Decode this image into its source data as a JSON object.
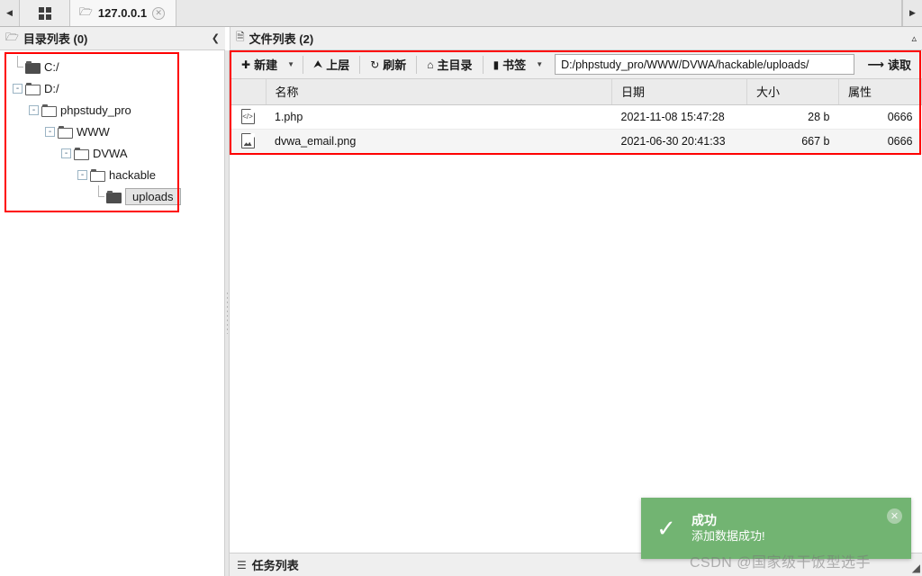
{
  "tabbar": {
    "nav_left_icon": "chevron-left-icon",
    "nav_right_icon": "chevron-right-icon",
    "grid_icon": "grid-icon",
    "tabs": [
      {
        "label": "127.0.0.1",
        "icon": "folder-icon",
        "close_icon": "close-icon"
      }
    ]
  },
  "left_panel": {
    "title": "目录列表 (0)",
    "title_icon": "folder-icon",
    "collapse_icon": "chevron-left-icon",
    "tree": [
      {
        "label": "C:/",
        "depth": 0,
        "toggle": "",
        "solid": true,
        "selected": false
      },
      {
        "label": "D:/",
        "depth": 0,
        "toggle": "-",
        "solid": false,
        "selected": false
      },
      {
        "label": "phpstudy_pro",
        "depth": 1,
        "toggle": "-",
        "solid": false,
        "selected": false
      },
      {
        "label": "WWW",
        "depth": 2,
        "toggle": "-",
        "solid": false,
        "selected": false
      },
      {
        "label": "DVWA",
        "depth": 3,
        "toggle": "-",
        "solid": false,
        "selected": false
      },
      {
        "label": "hackable",
        "depth": 4,
        "toggle": "-",
        "solid": false,
        "selected": false
      },
      {
        "label": "uploads",
        "depth": 5,
        "toggle": "",
        "solid": true,
        "selected": true
      }
    ]
  },
  "right_panel": {
    "title": "文件列表 (2)",
    "title_icon": "file-icon",
    "collapse_icon": "chevron-up-icon",
    "toolbar": {
      "new_label": "新建",
      "new_icon": "plus-circle-icon",
      "up_label": "上层",
      "up_icon": "arrow-up-icon",
      "refresh_label": "刷新",
      "refresh_icon": "refresh-icon",
      "home_label": "主目录",
      "home_icon": "home-icon",
      "bookmark_label": "书签",
      "bookmark_icon": "bookmark-icon",
      "caret_icon": "chevron-down-icon",
      "path_value": "D:/phpstudy_pro/WWW/DVWA/hackable/uploads/",
      "path_placeholder": "",
      "read_label": "读取",
      "read_icon": "arrow-right-icon"
    },
    "table": {
      "columns": [
        "名称",
        "日期",
        "大小",
        "属性"
      ],
      "rows": [
        {
          "icon": "php-file-icon",
          "name": "1.php",
          "date": "2021-11-08 15:47:28",
          "size": "28 b",
          "attr": "0666"
        },
        {
          "icon": "image-file-icon",
          "name": "dvwa_email.png",
          "date": "2021-06-30 20:41:33",
          "size": "667 b",
          "attr": "0666"
        }
      ]
    },
    "status": {
      "label": "任务列表",
      "icon": "list-icon"
    }
  },
  "toast": {
    "check_icon": "check-icon",
    "title": "成功",
    "message": "添加数据成功!",
    "close_icon": "close-icon"
  },
  "watermark": "CSDN @国家级干饭型选手",
  "resize_icon": "resize-grip-icon",
  "colors": {
    "highlight_box": "#fe0000",
    "toast_bg": "#72b472",
    "chrome": "#efefef"
  }
}
